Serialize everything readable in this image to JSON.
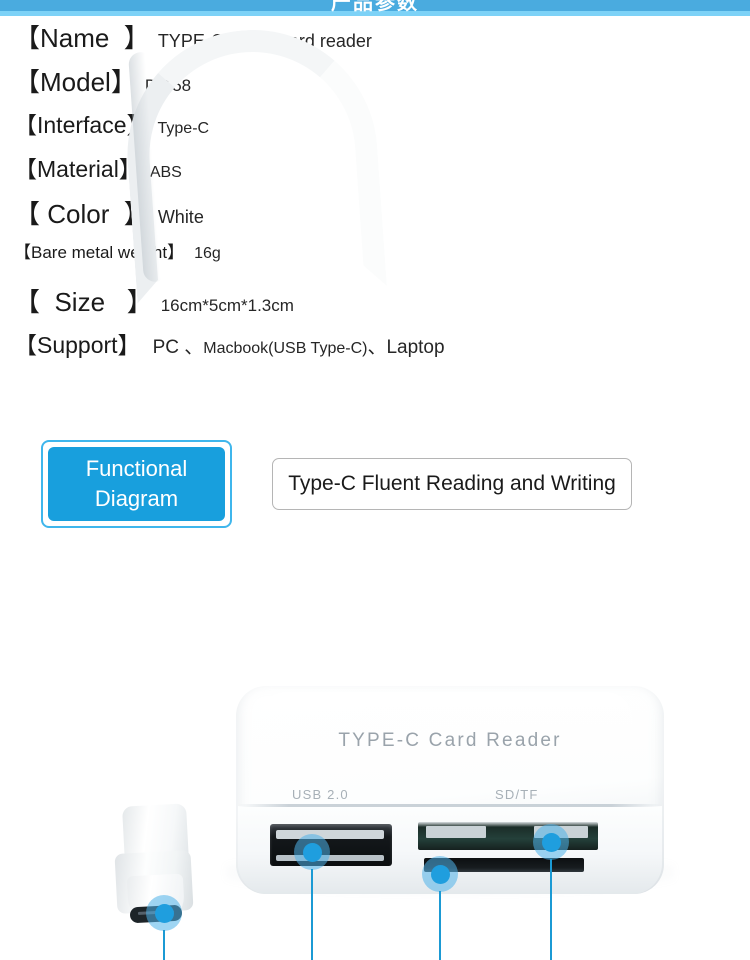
{
  "banner": {
    "title": "产品参数",
    "bar_color": "#4aabdf",
    "bar_accent_color": "#7dd2f7"
  },
  "specs": {
    "rows": [
      {
        "label": "【Name  】",
        "value": "TYPE-C 3-in-1 card reader"
      },
      {
        "label": "【Model】",
        "value": "D-158"
      },
      {
        "label": "【Interface】",
        "value": "Type-C"
      },
      {
        "label": "【Material】",
        "value": "ABS"
      },
      {
        "label": "【 Color  】",
        "value": "White"
      },
      {
        "label": "【Bare metal weight】",
        "value": "16g"
      },
      {
        "label": "【  Size   】",
        "value": "16cm*5cm*1.3cm"
      },
      {
        "label": "【Support】",
        "value_prefix": "PC 、",
        "value_sub": "Macbook(USB Type-C)",
        "value_suffix": "、Laptop"
      }
    ]
  },
  "sections": {
    "functional_diagram_badge": "Functional\nDiagram",
    "functional_diagram_line1": "Functional",
    "functional_diagram_line2": "Diagram",
    "feature_box": "Type-C Fluent Reading and Writing",
    "badge_fill_color": "#189fdd",
    "badge_border_color": "#3fb6ec"
  },
  "product": {
    "brand_text": "TYPE-C  Card  Reader",
    "port_label_usb": "USB 2.0",
    "port_label_sdtf": "SD/TF",
    "callout_color": "#1f9ede",
    "callouts": [
      {
        "name": "type-c-connector"
      },
      {
        "name": "usb-2-0-port"
      },
      {
        "name": "tf-card-slot"
      },
      {
        "name": "sd-card-slot"
      }
    ]
  }
}
